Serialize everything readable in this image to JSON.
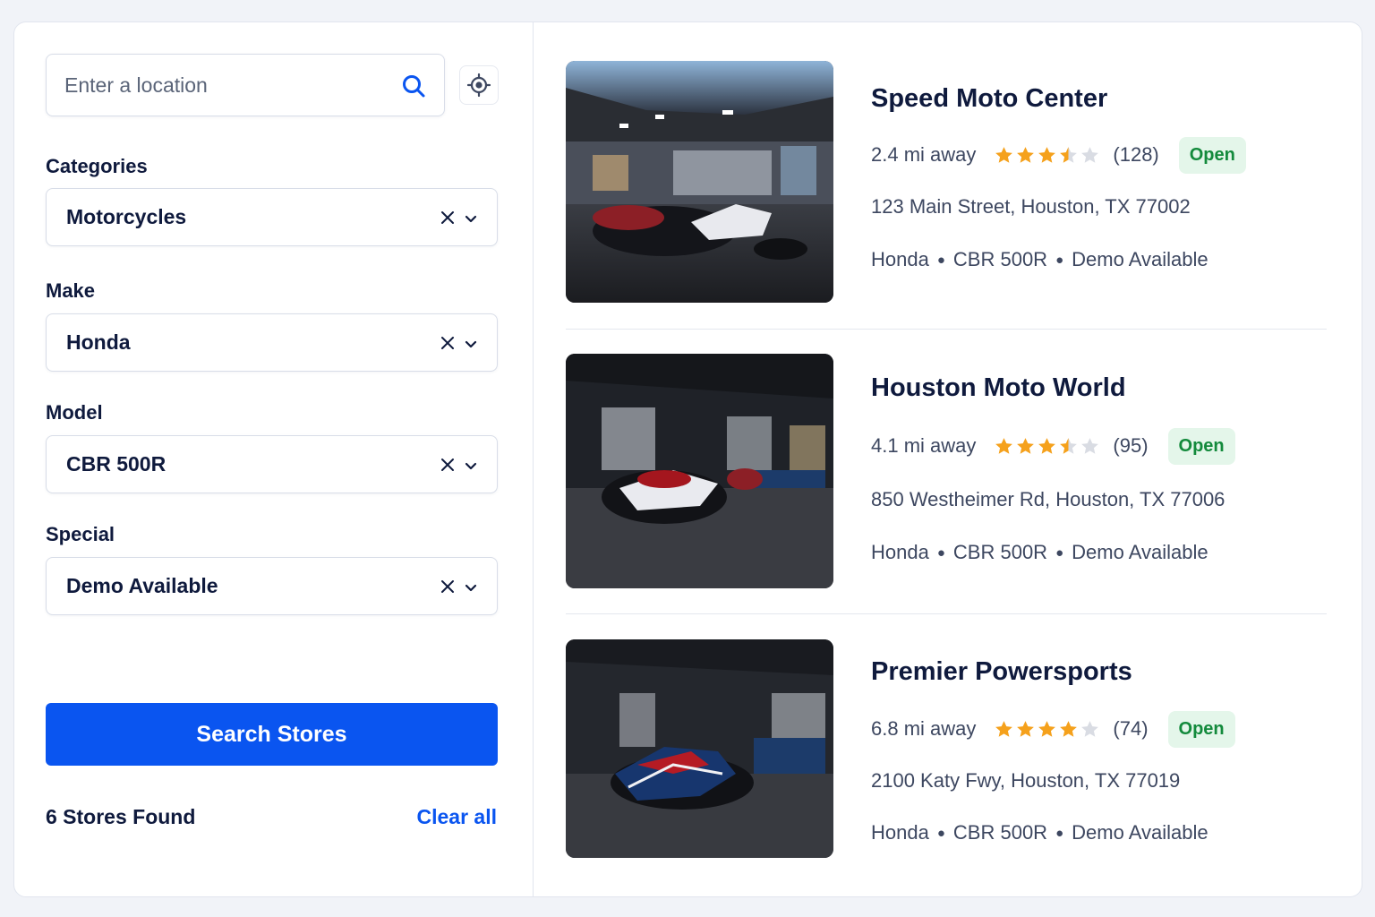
{
  "search": {
    "placeholder": "Enter a location"
  },
  "filters": [
    {
      "label": "Categories",
      "value": "Motorcycles"
    },
    {
      "label": "Make",
      "value": "Honda"
    },
    {
      "label": "Model",
      "value": "CBR 500R"
    },
    {
      "label": "Special",
      "value": "Demo Available"
    }
  ],
  "actions": {
    "search_label": "Search Stores",
    "results_count": "6 Stores Found",
    "clear_label": "Clear all"
  },
  "stores": [
    {
      "name": "Speed Moto Center",
      "distance": "2.4 mi away",
      "rating": 3.5,
      "reviews": "(128)",
      "status": "Open",
      "address": "123 Main Street, Houston, TX 77002",
      "tags": [
        "Honda",
        "CBR 500R",
        "Demo Available"
      ]
    },
    {
      "name": "Houston Moto World",
      "distance": "4.1 mi away",
      "rating": 3.5,
      "reviews": "(95)",
      "status": "Open",
      "address": "850 Westheimer Rd, Houston, TX 77006",
      "tags": [
        "Honda",
        "CBR 500R",
        "Demo Available"
      ]
    },
    {
      "name": "Premier Powersports",
      "distance": "6.8 mi away",
      "rating": 4,
      "reviews": "(74)",
      "status": "Open",
      "address": "2100 Katy Fwy, Houston, TX 77019",
      "tags": [
        "Honda",
        "CBR 500R",
        "Demo Available"
      ]
    }
  ],
  "colors": {
    "primary": "#0a55f0",
    "star": "#f5a11c",
    "star_empty": "#d9dce3",
    "open_bg": "#e4f6ea",
    "open_text": "#138a3c"
  }
}
